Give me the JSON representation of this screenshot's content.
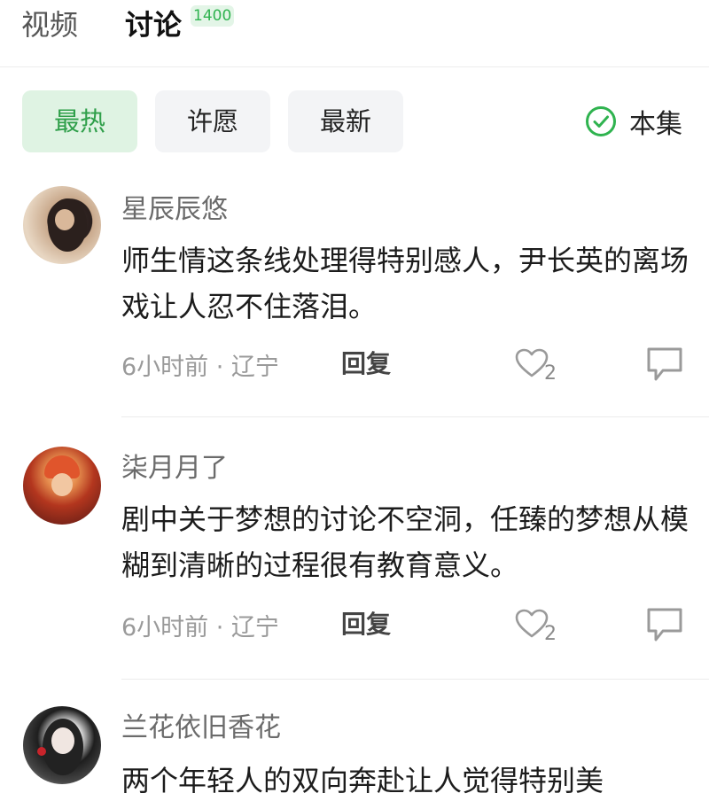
{
  "tabs": {
    "video_label": "视频",
    "discuss_label": "讨论",
    "discuss_count": "1400"
  },
  "filters": {
    "hot": "最热",
    "wish": "许愿",
    "new": "最新",
    "this_episode": "本集"
  },
  "colors": {
    "accent_green": "#2fb34f",
    "chip_active_bg": "#dff3e3"
  },
  "icons": [
    "check-circle-icon",
    "heart-icon",
    "comment-icon"
  ],
  "comments": [
    {
      "username": "星辰辰悠",
      "text": "师生情这条线处理得特别感人，尹长英的离场戏让人忍不住落泪。",
      "time_location": "6小时前 · 辽宁",
      "reply_label": "回复",
      "likes": "2"
    },
    {
      "username": "柒月月了",
      "text": "剧中关于梦想的讨论不空洞，任臻的梦想从模糊到清晰的过程很有教育意义。",
      "time_location": "6小时前 · 辽宁",
      "reply_label": "回复",
      "likes": "2"
    },
    {
      "username": "兰花依旧香花",
      "text": "两个年轻人的双向奔赴让人觉得特别美"
    }
  ]
}
